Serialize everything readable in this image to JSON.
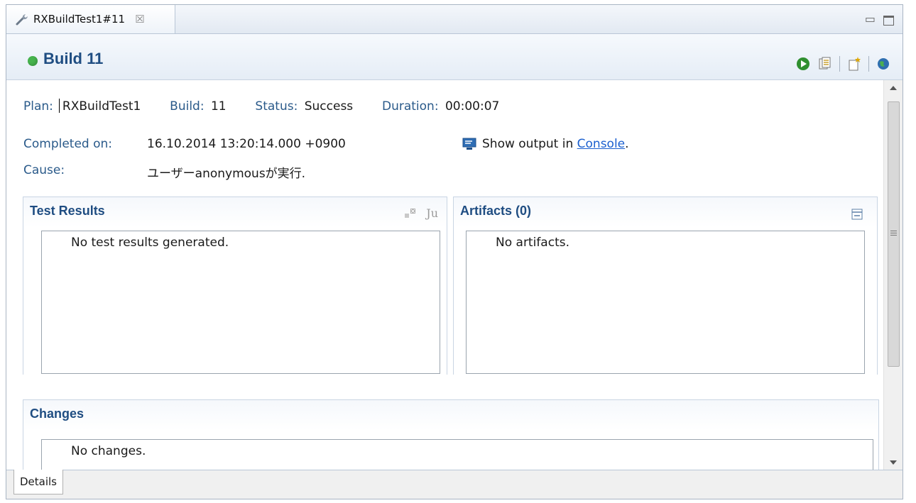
{
  "tab": {
    "title": "RXBuildTest1#11",
    "icon": "wrench-icon",
    "close_glyph": "☒"
  },
  "window_controls": {
    "minimize": "▭",
    "maximize": ""
  },
  "header": {
    "title": "Build 11",
    "status_color": "#46b34d"
  },
  "summary": {
    "plan_label": "Plan:",
    "plan_value": "RXBuildTest1",
    "build_label": "Build:",
    "build_value": "11",
    "status_label": "Status:",
    "status_value": "Success",
    "duration_label": "Duration:",
    "duration_value": "00:00:07",
    "completed_label": "Completed on:",
    "completed_value": "16.10.2014 13:20:14.000 +0900",
    "cause_label": "Cause:",
    "cause_value": "ユーザーanonymousが実行.",
    "console_prefix": "Show output in ",
    "console_link": "Console",
    "console_suffix": "."
  },
  "sections": {
    "test_results": {
      "title": "Test Results",
      "message": "No test results generated.",
      "junit_label": "Ju"
    },
    "artifacts": {
      "title": "Artifacts (0)",
      "message": "No artifacts."
    },
    "changes": {
      "title": "Changes",
      "message": "No changes."
    }
  },
  "bottom_tabs": {
    "details": "Details"
  }
}
